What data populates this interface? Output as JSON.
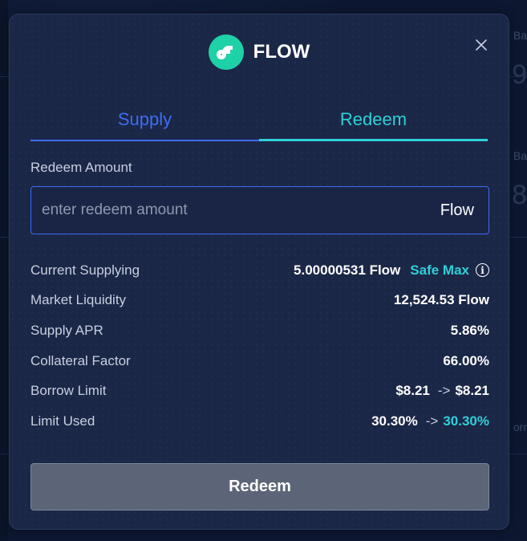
{
  "background": {
    "right_snippets": [
      "Ba",
      "9",
      "Ba",
      "8",
      "orr"
    ]
  },
  "modal": {
    "token_name": "FLOW",
    "token_icon": "flow-logo-icon",
    "close_icon": "close-icon"
  },
  "tabs": [
    {
      "label": "Supply",
      "active": false
    },
    {
      "label": "Redeem",
      "active": true
    }
  ],
  "amount": {
    "label": "Redeem Amount",
    "placeholder": "enter redeem amount",
    "value": "",
    "unit": "Flow"
  },
  "info": {
    "current_supplying": {
      "label": "Current Supplying",
      "value": "5.00000531 Flow",
      "action": "Safe Max"
    },
    "market_liquidity": {
      "label": "Market Liquidity",
      "value": "12,524.53 Flow"
    },
    "supply_apr": {
      "label": "Supply APR",
      "value": "5.86%"
    },
    "collateral_factor": {
      "label": "Collateral Factor",
      "value": "66.00%"
    },
    "borrow_limit": {
      "label": "Borrow Limit",
      "from": "$8.21",
      "arrow": "->",
      "to": "$8.21"
    },
    "limit_used": {
      "label": "Limit Used",
      "from": "30.30%",
      "arrow": "->",
      "to": "30.30%"
    }
  },
  "submit_label": "Redeem",
  "colors": {
    "accent_blue": "#3d6df2",
    "accent_teal": "#2fd0d8",
    "token_green": "#1fd1a6",
    "modal_bg": "#1b2747"
  }
}
